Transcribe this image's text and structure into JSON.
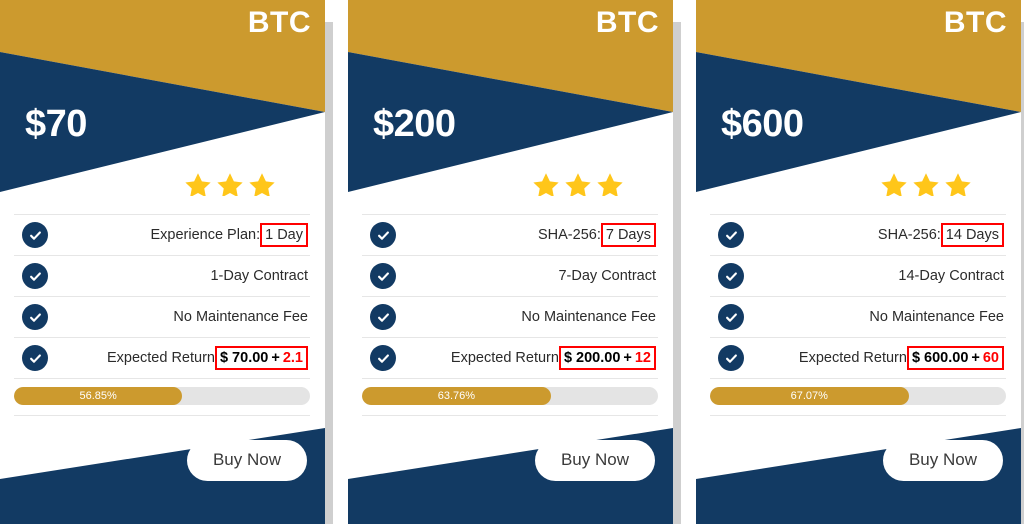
{
  "cards": [
    {
      "currency": "BTC",
      "price": "$70",
      "stars": 3,
      "features": [
        {
          "label": "Experience Plan:",
          "value": "1 Day",
          "boxed": true
        },
        {
          "label": "1-Day Contract",
          "value": "",
          "boxed": false
        },
        {
          "label": "No Maintenance Fee",
          "value": "",
          "boxed": false
        }
      ],
      "return_row": {
        "label": "Expected Return",
        "amount": "$ 70.00",
        "plus": "+",
        "gain": "2.1"
      },
      "progress": {
        "percent_label": "56.85%",
        "percent": 56.85
      },
      "buy_label": "Buy Now"
    },
    {
      "currency": "BTC",
      "price": "$200",
      "stars": 3,
      "features": [
        {
          "label": "SHA-256:",
          "value": "7 Days",
          "boxed": true
        },
        {
          "label": "7-Day Contract",
          "value": "",
          "boxed": false
        },
        {
          "label": "No Maintenance Fee",
          "value": "",
          "boxed": false
        }
      ],
      "return_row": {
        "label": "Expected Return",
        "amount": "$ 200.00",
        "plus": "+",
        "gain": "12"
      },
      "progress": {
        "percent_label": "63.76%",
        "percent": 63.76
      },
      "buy_label": "Buy Now"
    },
    {
      "currency": "BTC",
      "price": "$600",
      "stars": 3,
      "features": [
        {
          "label": "SHA-256:",
          "value": "14 Days",
          "boxed": true
        },
        {
          "label": "14-Day Contract",
          "value": "",
          "boxed": false
        },
        {
          "label": "No Maintenance Fee",
          "value": "",
          "boxed": false
        }
      ],
      "return_row": {
        "label": "Expected Return",
        "amount": "$ 600.00",
        "plus": "+",
        "gain": "60"
      },
      "progress": {
        "percent_label": "67.07%",
        "percent": 67.07
      },
      "buy_label": "Buy Now"
    }
  ],
  "icons": {
    "check": "check-circle-icon",
    "star": "star-icon"
  },
  "colors": {
    "gold": "#cc9a2e",
    "navy": "#123a63",
    "star": "#ffc61a",
    "highlight": "#ff0000",
    "track": "#e4e4e4"
  }
}
